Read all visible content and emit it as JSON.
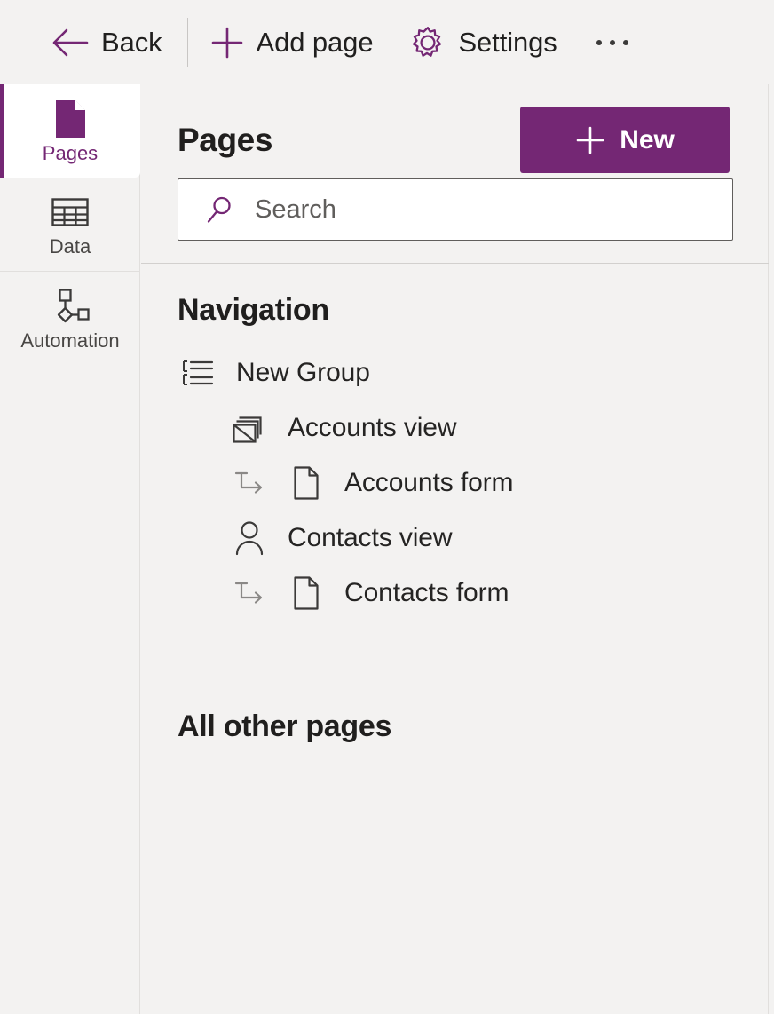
{
  "commandbar": {
    "items": [
      {
        "id": "back",
        "label": "Back",
        "icon": "arrow-left-icon"
      },
      {
        "id": "add-page",
        "label": "Add page",
        "icon": "plus-icon"
      },
      {
        "id": "settings",
        "label": "Settings",
        "icon": "gear-icon"
      }
    ],
    "overflow_label": "More commands",
    "overflow_icon": "ellipsis-icon"
  },
  "rail": {
    "items": [
      {
        "id": "pages",
        "label": "Pages",
        "icon": "page-icon",
        "selected": true
      },
      {
        "id": "data",
        "label": "Data",
        "icon": "table-icon",
        "selected": false
      },
      {
        "id": "automation",
        "label": "Automation",
        "icon": "flow-node-icon",
        "selected": false
      }
    ]
  },
  "panel": {
    "title": "Pages",
    "new_button": {
      "label": "New",
      "icon": "plus-icon"
    },
    "search": {
      "placeholder": "Search",
      "value": "",
      "icon": "search-icon"
    },
    "navigation_section": {
      "title": "Navigation",
      "items": [
        {
          "label": "New Group",
          "icon": "group-list-icon",
          "level": 0,
          "sub_arrow": false
        },
        {
          "label": "Accounts view",
          "icon": "view-stack-icon",
          "level": 1,
          "sub_arrow": false
        },
        {
          "label": "Accounts form",
          "icon": "page-outline-icon",
          "level": 2,
          "sub_arrow": true
        },
        {
          "label": "Contacts view",
          "icon": "person-icon",
          "level": 1,
          "sub_arrow": false
        },
        {
          "label": "Contacts form",
          "icon": "page-outline-icon",
          "level": 2,
          "sub_arrow": true
        }
      ]
    },
    "other_section": {
      "title": "All other pages"
    }
  },
  "colors": {
    "accent": "#742774",
    "background": "#f3f2f1",
    "surface": "#ffffff",
    "text": "#201f1e",
    "border": "#e1dfdd"
  }
}
